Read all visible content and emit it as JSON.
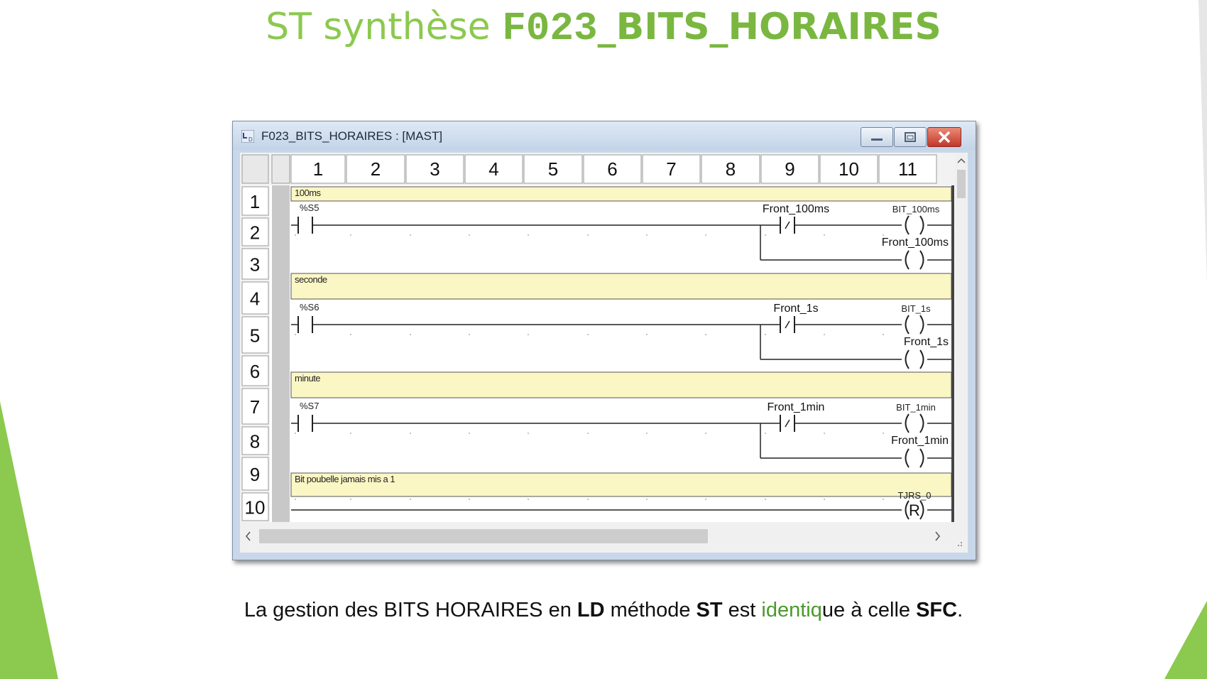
{
  "slide": {
    "title_prefix": "ST synthèse ",
    "title_code": "F023",
    "title_suffix": "_BITS_HORAIRES"
  },
  "window": {
    "title": "F023_BITS_HORAIRES : [MAST]",
    "controls": [
      "minimize-icon",
      "maximize-icon",
      "close-icon"
    ]
  },
  "ladder": {
    "column_headers": [
      "1",
      "2",
      "3",
      "4",
      "5",
      "6",
      "7",
      "8",
      "9",
      "10",
      "11"
    ],
    "row_headers": [
      "1",
      "2",
      "3",
      "4",
      "5",
      "6",
      "7",
      "8",
      "9",
      "10"
    ],
    "comments": [
      "100ms",
      "seconde",
      "minute",
      "Bit poubelle jamais mis a 1"
    ],
    "rungs": [
      {
        "contact": "%S5",
        "neg_contact": "Front_100ms",
        "coil1": "BIT_100ms",
        "coil2": "Front_100ms"
      },
      {
        "contact": "%S6",
        "neg_contact": "Front_1s",
        "coil1": "BIT_1s",
        "coil2": "Front_1s"
      },
      {
        "contact": "%S7",
        "neg_contact": "Front_1min",
        "coil1": "BIT_1min",
        "coil2": "Front_1min"
      }
    ],
    "reset_coil": {
      "label": "TJRS_0",
      "symbol": "R"
    }
  },
  "caption": {
    "p1": "La gestion des BITS HORAIRES en ",
    "b1": "LD",
    "p2": " méthode ",
    "b2": "ST",
    "p3": " est ",
    "h1": "identiq",
    "p4": "ue à celle ",
    "b3": "SFC",
    "p5": "."
  },
  "colors": {
    "title_green": "#8cc94f",
    "accent_green": "#8cc94f",
    "comment_yellow": "#fbf7c5",
    "window_frame": "#c8d8ea"
  }
}
